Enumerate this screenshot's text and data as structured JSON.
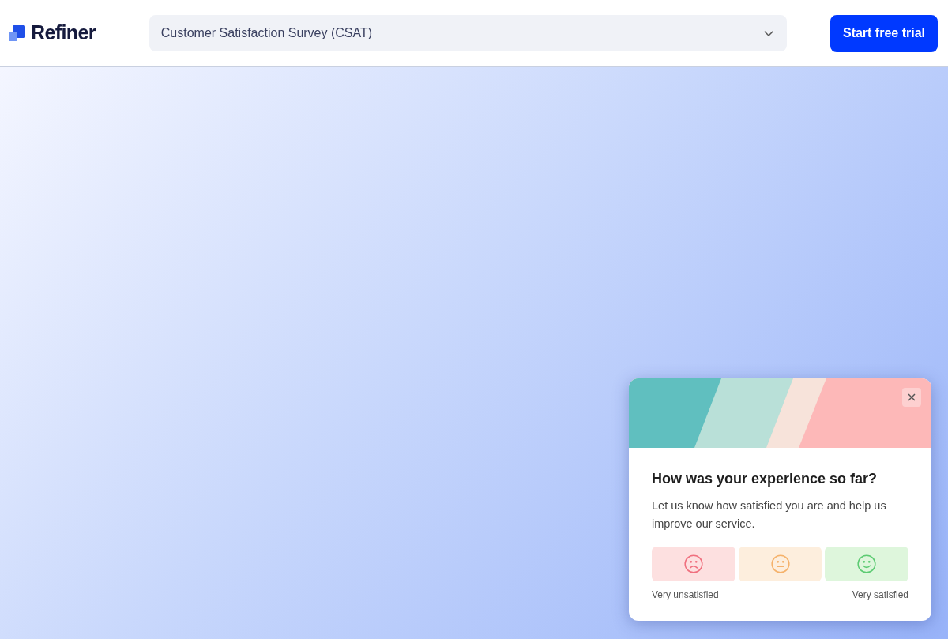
{
  "header": {
    "logo": "Refiner",
    "survey_select": {
      "value": "Customer Satisfaction Survey (CSAT)"
    },
    "cta": "Start free trial"
  },
  "popup": {
    "title": "How was your experience so far?",
    "description": "Let us know how satisfied you are and help us improve our service.",
    "ratings": [
      {
        "kind": "sad",
        "color": "#f0707f"
      },
      {
        "kind": "neutral",
        "color": "#f5b26b"
      },
      {
        "kind": "happy",
        "color": "#5dcb73"
      }
    ],
    "scale_labels": [
      "Very unsatisfied",
      "Very satisfied"
    ]
  }
}
